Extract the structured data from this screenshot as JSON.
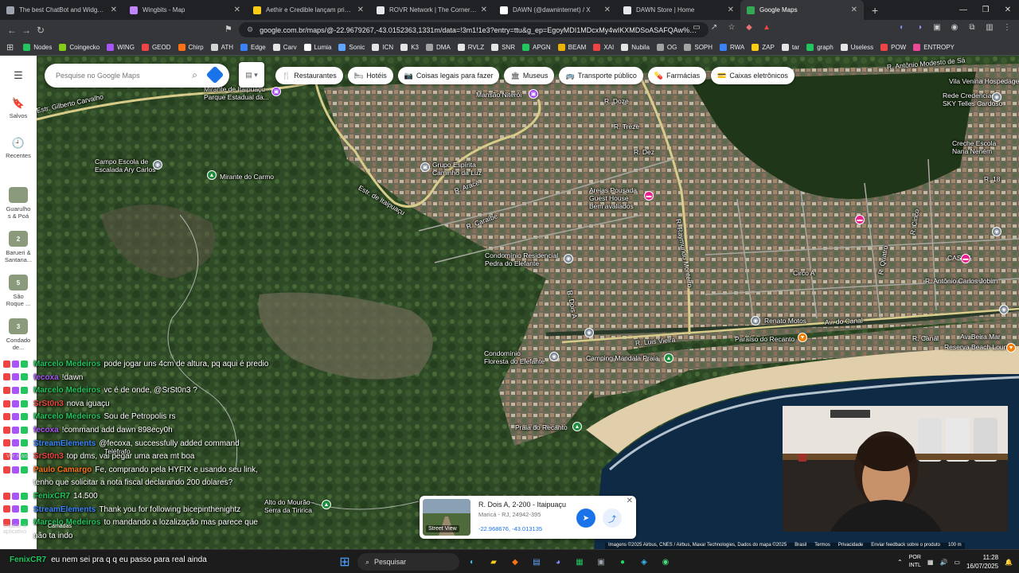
{
  "tabs": [
    {
      "title": "The best ChatBot and Widgets for K",
      "color": "#9ca3af"
    },
    {
      "title": "Wingbits - Map",
      "color": "#c084fc"
    },
    {
      "title": "Aethir e Credible lançam primeiro co",
      "color": "#facc15"
    },
    {
      "title": "ROVR Network | The Cornerstone of",
      "color": "#e5e7eb"
    },
    {
      "title": "DAWN (@dawninternet) / X",
      "color": "#ffffff"
    },
    {
      "title": "DAWN Store | Home",
      "color": "#e5e7eb"
    },
    {
      "title": "Google Maps",
      "color": "#34a853"
    }
  ],
  "address": {
    "url": "google.com.br/maps/@-22.9679267,-43.0152363,1331m/data=!3m1!1e3?entry=ttu&g_ep=EgoyMDI1MDcxMy4wIKXMDSoASAFQAw%3D%3D"
  },
  "bookmarks": [
    {
      "label": "Nodes",
      "color": "#22c55e"
    },
    {
      "label": "Coingecko",
      "color": "#84cc16"
    },
    {
      "label": "WING",
      "color": "#a855f7"
    },
    {
      "label": "GEOD",
      "color": "#ef4444"
    },
    {
      "label": "Chirp",
      "color": "#f97316"
    },
    {
      "label": "ATH",
      "color": "#d4d4d4"
    },
    {
      "label": "Edge",
      "color": "#3b82f6"
    },
    {
      "label": "Carv",
      "color": "#e5e5e5"
    },
    {
      "label": "Lumia",
      "color": "#ffffff"
    },
    {
      "label": "Sonic",
      "color": "#60a5fa"
    },
    {
      "label": "ICN",
      "color": "#e5e5e5"
    },
    {
      "label": "K3",
      "color": "#e5e5e5"
    },
    {
      "label": "DMA",
      "color": "#a3a3a3"
    },
    {
      "label": "RVLZ",
      "color": "#e5e5e5"
    },
    {
      "label": "SNR",
      "color": "#e5e5e5"
    },
    {
      "label": "APGN",
      "color": "#22c55e"
    },
    {
      "label": "BEAM",
      "color": "#eab308"
    },
    {
      "label": "XAI",
      "color": "#ef4444"
    },
    {
      "label": "Nubila",
      "color": "#e5e5e5"
    },
    {
      "label": "OG",
      "color": "#a3a3a3"
    },
    {
      "label": "SOPH",
      "color": "#a3a3a3"
    },
    {
      "label": "RWA",
      "color": "#3b82f6"
    },
    {
      "label": "ZAP",
      "color": "#facc15"
    },
    {
      "label": "tar",
      "color": "#e5e5e5"
    },
    {
      "label": "graph",
      "color": "#22c55e"
    },
    {
      "label": "Useless",
      "color": "#e5e5e5"
    },
    {
      "label": "POW",
      "color": "#ef4444"
    },
    {
      "label": "ENTROPY",
      "color": "#ec4899"
    }
  ],
  "rail": {
    "saved": "Salvos",
    "recent": "Recentes",
    "items": [
      {
        "label": "Guarulho\ns & Poá",
        "num": ""
      },
      {
        "label": "Barueri &\nSantana...",
        "num": "2"
      },
      {
        "label": "São\nRoque ...",
        "num": "5"
      },
      {
        "label": "Condado\nde...",
        "num": "3"
      }
    ]
  },
  "search": {
    "placeholder": "Pesquise no Google Maps"
  },
  "chips": [
    {
      "label": "Restaurantes",
      "icon": "fork-knife-icon",
      "glyph": "🍴"
    },
    {
      "label": "Hotéis",
      "icon": "bed-icon",
      "glyph": "🛏"
    },
    {
      "label": "Coisas legais para fazer",
      "icon": "camera-icon",
      "glyph": "📷"
    },
    {
      "label": "Museus",
      "icon": "museum-icon",
      "glyph": "🏛"
    },
    {
      "label": "Transporte público",
      "icon": "bus-icon",
      "glyph": "🚌"
    },
    {
      "label": "Farmácias",
      "icon": "pharmacy-icon",
      "glyph": "💊"
    },
    {
      "label": "Caixas eletrônicos",
      "icon": "atm-icon",
      "glyph": "💳"
    }
  ],
  "map_labels": [
    {
      "text": "Mirante de Itaipuaçu -\nParque Estadual da..."
    },
    {
      "text": "Estr. Gilberto Carvalho"
    },
    {
      "text": "Campo Escola de\nEscalada Ary Carlos"
    },
    {
      "text": "Mirante do Carmo"
    },
    {
      "text": "Mansão Niterói"
    },
    {
      "text": "Grupo Espírita\nCaminho da Luz"
    },
    {
      "text": "Estr. de Itaipuaçu"
    },
    {
      "text": "Areias Pousada\nGuest House\nBem avaliados"
    },
    {
      "text": "Condomínio Residencial\nPedra do Elefante"
    },
    {
      "text": "R. Raymundo Monteiro"
    },
    {
      "text": "Renato Motos"
    },
    {
      "text": "Av. do Canal"
    },
    {
      "text": "Paraíso do Recanto"
    },
    {
      "text": "Reserva Beach Lounge"
    },
    {
      "text": "Condomínio\nFloresta do Elefante"
    },
    {
      "text": "Camping Mandala Praia"
    },
    {
      "text": "Praia do Recanto"
    },
    {
      "text": "R. Luis Vieira"
    },
    {
      "text": "Alto do Mourão -\nSerra da Tiririca"
    },
    {
      "text": "R. Antônio Modesto de Sá"
    },
    {
      "text": "Vila Venina Hospedage"
    },
    {
      "text": "Rede Credenciada\nSKY Telles Cardoso"
    },
    {
      "text": "Creche Escola\nNana Neném"
    },
    {
      "text": "CASA 6"
    },
    {
      "text": "R. Antônio Carlos Jobim"
    },
    {
      "text": "R. Doze"
    },
    {
      "text": "R. Treze"
    },
    {
      "text": "R. Dez"
    },
    {
      "text": "Circo A"
    },
    {
      "text": "R. Cinco"
    },
    {
      "text": "R. Quatro"
    },
    {
      "text": "R. Aracê"
    },
    {
      "text": "R. Caraíbe"
    },
    {
      "text": "R. Dois A"
    },
    {
      "text": "R. Canal"
    },
    {
      "text": "Av. Beira Mar"
    },
    {
      "text": "R. 18"
    },
    {
      "text": "Teléfrafo"
    }
  ],
  "chat": [
    {
      "user": "Marcelo Medeiros",
      "text": "pode jogar uns 4cm de altura, pq aqui é predio",
      "color": "#22c55e"
    },
    {
      "user": "fecoxa",
      "text": "!dawn",
      "color": "#a855f7"
    },
    {
      "user": "Marcelo Medeiros",
      "text": "vc é de onde, @SrSt0n3 ?",
      "color": "#22c55e"
    },
    {
      "user": "SrSt0n3",
      "text": "nova iguaçu",
      "color": "#ef4444"
    },
    {
      "user": "Marcelo Medeiros",
      "text": "Sou de Petropolis rs",
      "color": "#22c55e"
    },
    {
      "user": "fecoxa",
      "text": "!command add dawn 898ecy0h",
      "color": "#a855f7"
    },
    {
      "user": "StreamElements",
      "text": "@fecoxa, successfully added command",
      "color": "#3b82f6"
    },
    {
      "user": "SrSt0n3",
      "text": "top dms, vai pegar uma area mt boa",
      "color": "#ef4444"
    },
    {
      "user": "Paulo Camargo",
      "text": "Fe, comprando pela HYFIX e usando seu link,",
      "color": "#f97316"
    },
    {
      "user": "",
      "text": "tenho que solicitar a nota fiscal declarando 200 dolares?",
      "color": "#ffffff"
    },
    {
      "user": "FenixCR7",
      "text": "14.500",
      "color": "#22c55e"
    },
    {
      "user": "StreamElements",
      "text": "Thank you for following bicepinthenightz",
      "color": "#3b82f6"
    },
    {
      "user": "Marcelo Medeiros",
      "text": "to mandando a lozalização mas parece que",
      "color": "#22c55e"
    },
    {
      "user": "",
      "text": "não ta indo",
      "color": "#ffffff"
    }
  ],
  "ticker": {
    "user": "FenixCR7",
    "text": "eu nem sei pra q q eu passo para real ainda"
  },
  "location_card": {
    "title": "R. Dois A, 2-200 - Itaipuaçu",
    "subtitle": "Maricá - RJ, 24942-395",
    "coords": "-22.968676, -43.013135",
    "street_view": "Street View"
  },
  "attribution": [
    "Imagens ©2025 Airbus, CNES / Airbus, Maxar Technologies, Dados do mapa ©2025",
    "Brasil",
    "Termos",
    "Privacidade",
    "Enviar feedback sobre o produto",
    "100 m"
  ],
  "layers_label": "Camadas",
  "rail_extra": [
    "Ver mais",
    "Instalar o\naplicativo"
  ],
  "taskbar": {
    "search": "Pesquisar",
    "lang": "POR\nINTL",
    "time": "11:28",
    "date": "16/07/2025"
  }
}
